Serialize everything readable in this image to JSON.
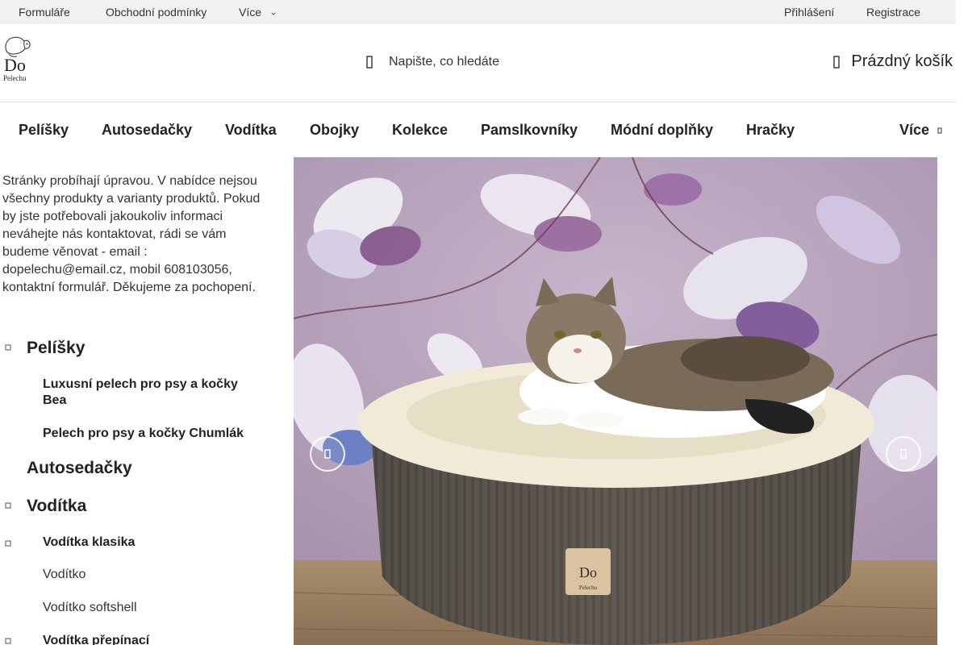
{
  "topbar": {
    "links": [
      "Formuláře",
      "Obchodní podmínky",
      "Více"
    ],
    "login": "Přihlášení",
    "register": "Registrace"
  },
  "logo": {
    "word": "Do",
    "sub": "Pelechu"
  },
  "search": {
    "placeholder": "Napište, co hledáte"
  },
  "cart": {
    "label": "Prázdný košík"
  },
  "nav": {
    "items": [
      "Pelíšky",
      "Autosedačky",
      "Vodítka",
      "Obojky",
      "Kolekce",
      "Pamslkovníky",
      "Módní doplňky",
      "Hračky"
    ],
    "more": "Více"
  },
  "notice": "Stránky probíhají úpravou. V nabídce nejsou všechny produkty a varianty produktů. Pokud by jste potřebovali jakoukoliv informaci neváhejte nás kontaktovat, rádi se vám budeme věnovat - email : dopelechu@email.cz, mobil 608103056, kontaktní formulář. Děkujeme za pochopení.",
  "categories": {
    "pelisky": "Pelíšky",
    "luxusni": "Luxusní pelech pro psy a kočky Bea",
    "chumlak": "Pelech pro psy a kočky Chumlák",
    "autosedacky": "Autosedačky",
    "voditka": "Vodítka",
    "voditka_klasika": "Vodítka klasika",
    "voditko": "Vodítko",
    "voditko_softshell": "Vodítko softshell",
    "voditka_prepinaci": "Vodítka přepínací"
  },
  "banner": {
    "bed_logo_word": "Do",
    "bed_logo_sub": "Pelechu"
  },
  "colors": {
    "topbar_bg": "#f2f2f2",
    "text": "#222222",
    "banner_wall": "#b9a7bf"
  }
}
